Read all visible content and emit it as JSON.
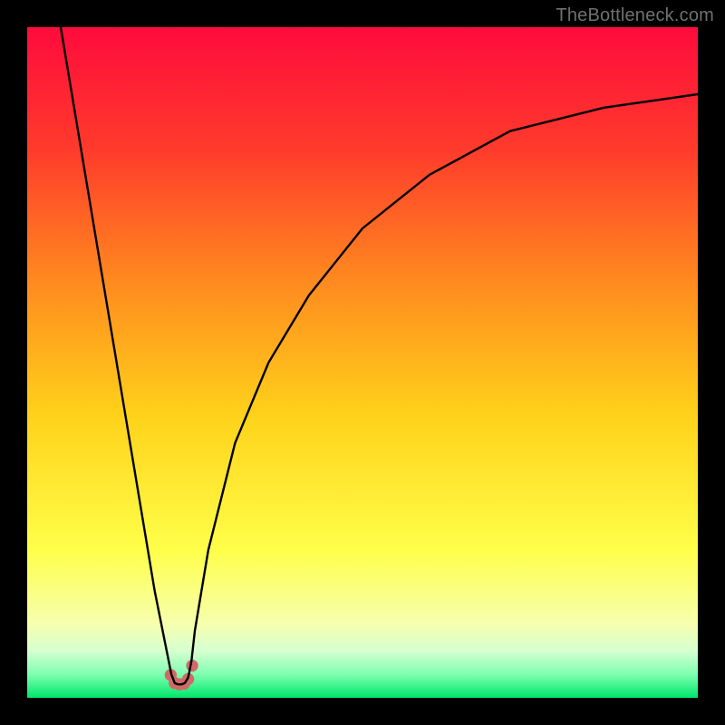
{
  "watermark": "TheBottleneck.com",
  "chart_data": {
    "type": "line",
    "title": "",
    "xlabel": "",
    "ylabel": "",
    "xlim": [
      0,
      100
    ],
    "ylim": [
      0,
      100
    ],
    "grid": false,
    "legend": false,
    "background_gradient_stops": [
      {
        "offset": 0.0,
        "color": "#ff0b3c"
      },
      {
        "offset": 0.18,
        "color": "#ff3a2c"
      },
      {
        "offset": 0.38,
        "color": "#ff8a1f"
      },
      {
        "offset": 0.58,
        "color": "#ffd21a"
      },
      {
        "offset": 0.78,
        "color": "#ffff4a"
      },
      {
        "offset": 0.89,
        "color": "#f6ffae"
      },
      {
        "offset": 0.93,
        "color": "#d6ffd0"
      },
      {
        "offset": 0.965,
        "color": "#7effb0"
      },
      {
        "offset": 1.0,
        "color": "#00e66a"
      }
    ],
    "series": [
      {
        "name": "bottleneck-curve",
        "x": [
          5,
          7,
          9,
          11,
          13,
          15,
          17,
          19,
          21,
          21.5,
          22,
          22.5,
          23,
          23.5,
          24,
          24.5,
          25,
          27,
          31,
          36,
          42,
          50,
          60,
          72,
          86,
          100
        ],
        "y": [
          100,
          88,
          76,
          64,
          52,
          40,
          28,
          16,
          6,
          3.5,
          2.2,
          2.0,
          2.0,
          2.2,
          3.0,
          5.5,
          10,
          22,
          38,
          50,
          60,
          70,
          78,
          84.5,
          88,
          90
        ]
      }
    ],
    "markers": {
      "name": "reference-markers",
      "color": "#d06a67",
      "radius_data_units": 0.9,
      "points": [
        {
          "x": 21.4,
          "y": 3.4
        },
        {
          "x": 22.0,
          "y": 2.2
        },
        {
          "x": 22.7,
          "y": 2.0
        },
        {
          "x": 23.4,
          "y": 2.1
        },
        {
          "x": 24.0,
          "y": 2.8
        },
        {
          "x": 24.6,
          "y": 4.8
        }
      ]
    }
  }
}
